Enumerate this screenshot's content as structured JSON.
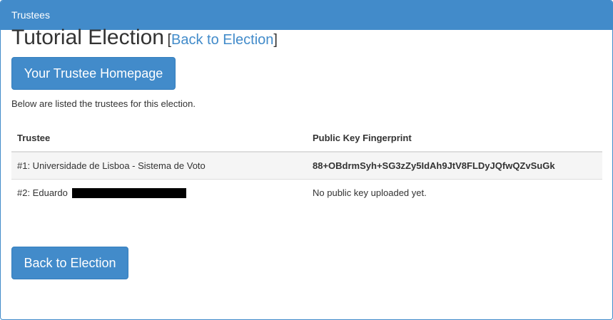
{
  "panel": {
    "heading": "Trustees"
  },
  "page": {
    "title": "Tutorial Election",
    "bracket_open": "[",
    "back_link": "Back to Election",
    "bracket_close": "]"
  },
  "buttons": {
    "trustee_homepage": "Your Trustee Homepage",
    "back_to_election": "Back to Election"
  },
  "intro_text": "Below are listed the trustees for this election.",
  "table": {
    "headers": [
      "Trustee",
      "Public Key Fingerprint"
    ],
    "rows": [
      {
        "trustee": "#1: Universidade de Lisboa - Sistema de Voto",
        "fingerprint": "88+OBdrmSyh+SG3zZy5IdAh9JtV8FLDyJQfwQZvSuGk"
      },
      {
        "trustee": "#2: Eduardo",
        "fingerprint": "No public key uploaded yet."
      }
    ]
  },
  "colors": {
    "primary": "#428bca",
    "text": "#333333",
    "stripe": "#f5f5f5"
  }
}
